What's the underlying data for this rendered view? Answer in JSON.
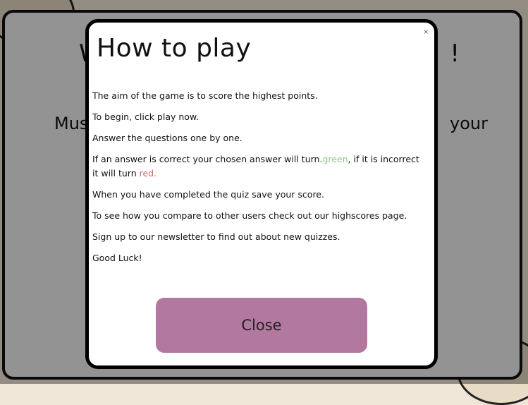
{
  "background_page": {
    "heading_left": "W",
    "heading_right": "!",
    "subheading_left": "Mus",
    "subheading_right": "your"
  },
  "modal": {
    "title": "How to play",
    "close_x": "×",
    "instructions": [
      "The aim of the game is to score the highest points.",
      "To begin, click play now.",
      "Answer the questions one by one."
    ],
    "answer_line": {
      "before": "If an answer is correct your chosen answer will turn.",
      "green_word": "green",
      "middle": ", if it is incorrect it will turn ",
      "red_word": "red."
    },
    "instructions_after": [
      "When you have completed the quiz save your score.",
      "To see how you compare to other users check out our highscores page.",
      "Sign up to our newsletter to find out about new quizzes.",
      "Good Luck!"
    ],
    "close_button_label": "Close"
  },
  "colors": {
    "close_button": "#b3789f",
    "green_text": "#8fc98a",
    "red_text": "#c96a6a",
    "overlay": "rgba(0,0,0,0.40)"
  }
}
